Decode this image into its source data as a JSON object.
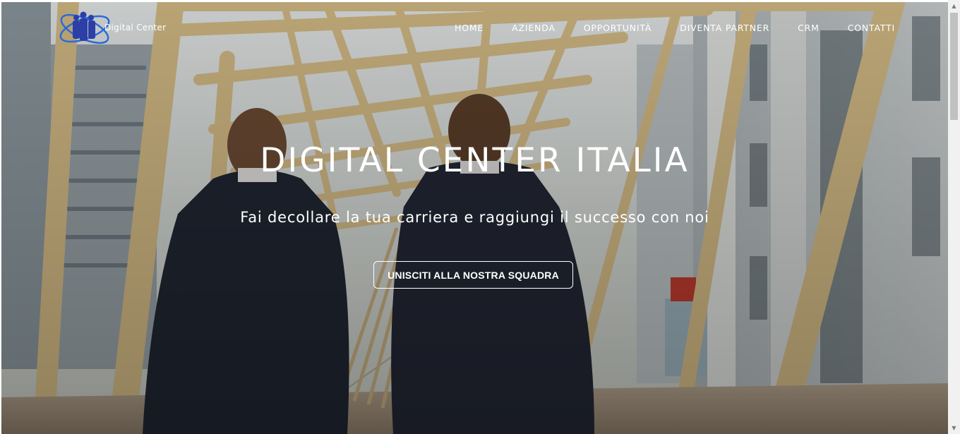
{
  "header": {
    "logo_text": "Digital Center",
    "logo_icon": "people-orbit-logo-icon",
    "nav": [
      {
        "label": "HOME"
      },
      {
        "label": "AZIENDA"
      },
      {
        "label": "OPPORTUNITÀ"
      },
      {
        "label": "DIVENTA PARTNER"
      },
      {
        "label": "CRM"
      },
      {
        "label": "CONTATTI"
      }
    ]
  },
  "hero": {
    "title": "DIGITAL CENTER ITALIA",
    "subtitle": "Fai decollare la tua carriera e raggiungi il successo con noi",
    "cta_label": "UNISCITI ALLA NOSTRA SQUADRA",
    "background_description": "two men in suits walking on a bridge with wooden arch structure"
  },
  "colors": {
    "text": "#ffffff",
    "cta_border": "#ffffff",
    "logo_blue": "#2b4fc9"
  }
}
